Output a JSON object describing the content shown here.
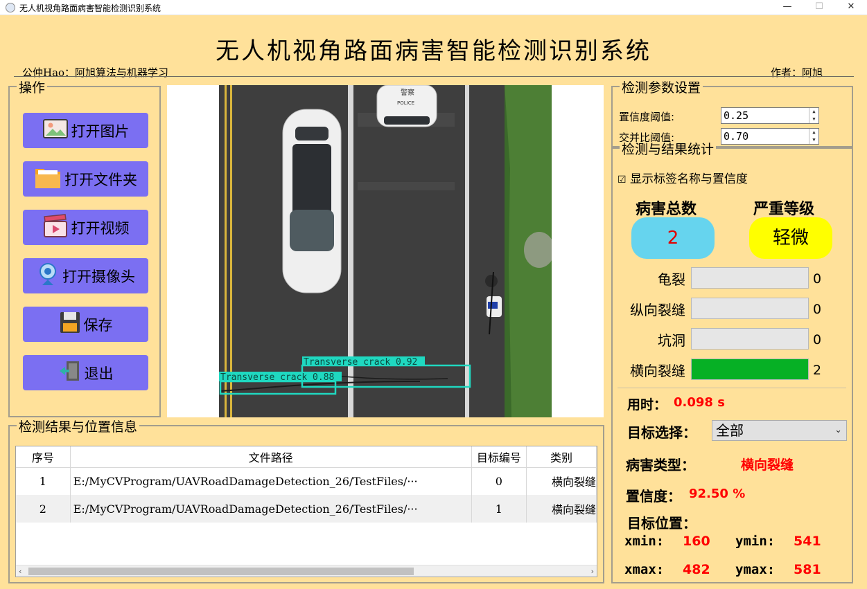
{
  "window": {
    "title": "无人机视角路面病害智能检测识别系统",
    "minimize": "—",
    "maximize": "☐",
    "close": "✕"
  },
  "header": {
    "title": "无人机视角路面病害智能检测识别系统",
    "left_text": "公仲Hao：阿旭算法与机器学习",
    "right_text": "作者：阿旭"
  },
  "operations": {
    "title": "操作",
    "buttons": [
      {
        "label": "打开图片",
        "icon": "image-icon"
      },
      {
        "label": "打开文件夹",
        "icon": "folder-icon"
      },
      {
        "label": "打开视频",
        "icon": "video-icon"
      },
      {
        "label": "打开摄像头",
        "icon": "webcam-icon"
      },
      {
        "label": "保存",
        "icon": "save-icon"
      },
      {
        "label": "退出",
        "icon": "exit-icon"
      }
    ]
  },
  "detection_overlay": [
    {
      "label": "Transverse crack 0.92"
    },
    {
      "label": "Transverse crack 0.88"
    }
  ],
  "photo_text": {
    "car_roof_1": "警察",
    "car_roof_2": "POLICE"
  },
  "params": {
    "title": "检测参数设置",
    "conf_label": "置信度阈值:",
    "conf_value": "0.25",
    "iou_label": "交并比阈值:",
    "iou_value": "0.70"
  },
  "stats": {
    "title": "检测与结果统计",
    "show_labels_checkbox": "显示标签名称与置信度",
    "checkbox_checked": true,
    "total_label": "病害总数",
    "total_value": "2",
    "level_label": "严重等级",
    "level_value": "轻微",
    "categories": [
      {
        "name": "龟裂",
        "count": "0",
        "fraction": 0
      },
      {
        "name": "纵向裂缝",
        "count": "0",
        "fraction": 0
      },
      {
        "name": "坑洞",
        "count": "0",
        "fraction": 0
      },
      {
        "name": "横向裂缝",
        "count": "2",
        "fraction": 1
      }
    ],
    "time_label": "用时：",
    "time_value": "0.098 s",
    "target_label": "目标选择：",
    "target_value": "全部",
    "type_label": "病害类型：",
    "type_value": "横向裂缝",
    "conf_label": "置信度：",
    "conf_value": "92.50 %",
    "pos_label": "目标位置：",
    "xmin_label": "xmin:",
    "xmin": "160",
    "ymin_label": "ymin:",
    "ymin": "541",
    "xmax_label": "xmax:",
    "xmax": "482",
    "ymax_label": "ymax:",
    "ymax": "581"
  },
  "results": {
    "title": "检测结果与位置信息",
    "columns": [
      "序号",
      "文件路径",
      "目标编号",
      "类别"
    ],
    "rows": [
      {
        "index": "1",
        "path": "E:/MyCVProgram/UAVRoadDamageDetection_26/TestFiles/···",
        "target": "0",
        "class": "横向裂缝"
      },
      {
        "index": "2",
        "path": "E:/MyCVProgram/UAVRoadDamageDetection_26/TestFiles/···",
        "target": "1",
        "class": "横向裂缝"
      }
    ],
    "scroll_left": "‹",
    "scroll_right": "›"
  },
  "colors": {
    "background": "#ffe19a",
    "button": "#7b6ff2",
    "count_box": "#66d4ee",
    "level_box": "#ffff00",
    "bar_fill": "#06b025",
    "accent_red": "#ff0000",
    "detection_box": "#1fd8c0"
  }
}
